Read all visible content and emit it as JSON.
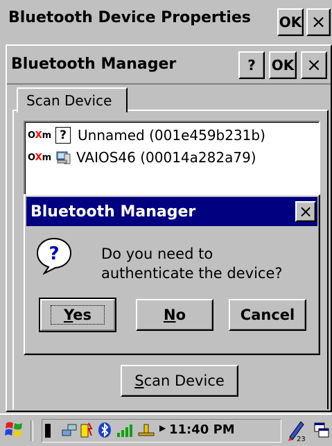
{
  "outer_window": {
    "title": "Bluetooth Device Properties",
    "ok_label": "OK",
    "close_label": "×"
  },
  "manager_window": {
    "title": "Bluetooth Manager",
    "help_label": "?",
    "ok_label": "OK",
    "close_label": "×",
    "tab_label": "Scan Device",
    "devices": [
      {
        "name": "Unnamed (001e459b231b)",
        "icon": "unknown-device-icon"
      },
      {
        "name": "VAIOS46 (00014a282a79)",
        "icon": "computer-device-icon"
      }
    ],
    "scan_button_label": "Scan Device"
  },
  "dialog": {
    "title": "Bluetooth Manager",
    "close_label": "×",
    "icon": "question-icon",
    "message_line1": "Do you need to",
    "message_line2": "authenticate the device?",
    "yes_label": "Yes",
    "no_label": "No",
    "cancel_label": "Cancel"
  },
  "taskbar": {
    "start_icon": "windows-flag-icon",
    "clock": "11:40 PM",
    "tray_icons": [
      "network-icon",
      "battery-icon",
      "bluetooth-icon",
      "signal-icon",
      "connection-icon",
      "input-panel-icon",
      "window-switch-icon"
    ]
  },
  "colors": {
    "face": "#c0c0c0",
    "dialog_title_bg": "#000080",
    "dialog_title_text": "#ffffff",
    "disconnected_mark": "#ff0000"
  }
}
